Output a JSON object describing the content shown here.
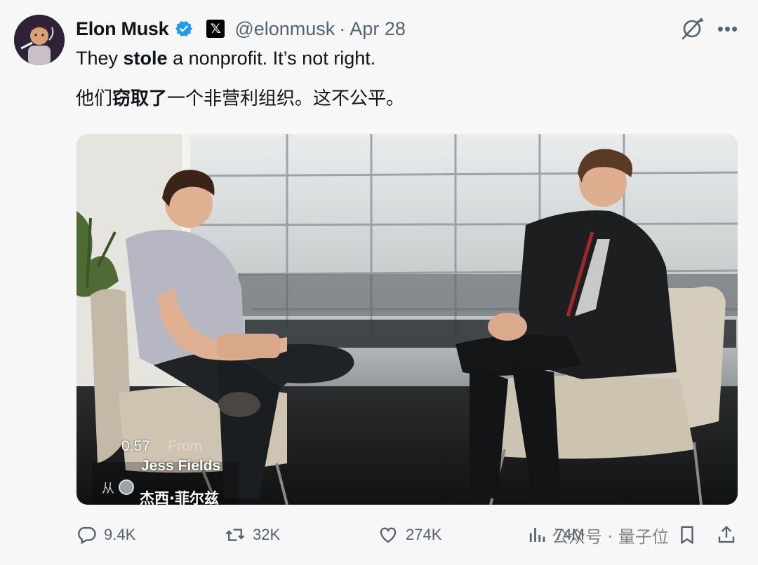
{
  "author": {
    "name": "Elon Musk",
    "x_badge": "𝕏",
    "handle": "@elonmusk",
    "separator": "·",
    "date": "Apr 28"
  },
  "text": {
    "en_pre": "They ",
    "en_bold": "stole",
    "en_post": " a nonprofit. It’s not right.",
    "zh_pre": "他们",
    "zh_bold": "窃取了",
    "zh_post": "一个非营利组织。这不公平。"
  },
  "video": {
    "timestamp": "0:57",
    "from_label": "From",
    "from_name": "Jess Fields",
    "subtitle_zh": "杰西·菲尔兹",
    "small_glyph": "从"
  },
  "actions": {
    "replies": "9.4K",
    "reposts": "32K",
    "likes": "274K",
    "views": "74M"
  },
  "watermark": "公众号 · 量子位",
  "colors": {
    "verified": "#1d9bf0",
    "muted": "#536471",
    "text": "#0f1419",
    "background": "#f7f7f7"
  },
  "icons": [
    "verified-icon",
    "x-badge-icon",
    "grok-icon",
    "more-icon",
    "reply-icon",
    "repost-icon",
    "like-icon",
    "views-icon",
    "bookmark-icon",
    "share-icon"
  ]
}
